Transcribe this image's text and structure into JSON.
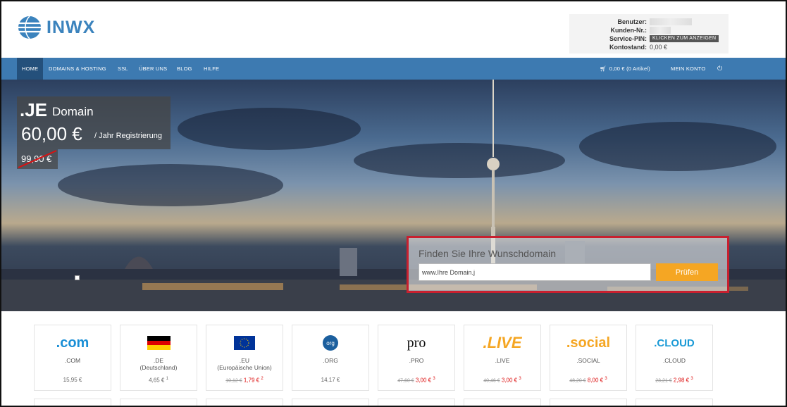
{
  "header": {
    "logo_text": "INWX",
    "account": {
      "user_label": "Benutzer:",
      "customer_label": "Kunden-Nr.:",
      "pin_label": "Service-PIN:",
      "pin_button": "KLICKEN ZUM ANZEIGEN",
      "balance_label": "Kontostand:",
      "balance_value": "0,00 €"
    }
  },
  "nav": {
    "items": [
      "HOME",
      "DOMAINS & HOSTING",
      "SSL",
      "ÜBER UNS",
      "BLOG",
      "HILFE"
    ],
    "cart": "0,00 € (0 Artikel)",
    "account": "MEIN KONTO"
  },
  "hero": {
    "promo_tld": ".JE",
    "promo_domain": "Domain",
    "promo_price": "60,00 €",
    "promo_per": "/ Jahr Registrierung",
    "promo_old_price": "99,90 €",
    "search_title": "Finden Sie Ihre Wunschdomain",
    "search_value": "www.Ihre Domain.j",
    "search_button": "Prüfen"
  },
  "tlds": [
    {
      "logo": ".com",
      "name": ".COM",
      "sub": "",
      "old": "",
      "price": "15,95 €",
      "sup": ""
    },
    {
      "logo": "flag-de",
      "name": ".DE",
      "sub": "(Deutschland)",
      "old": "",
      "price": "4,65 €",
      "sup": "1"
    },
    {
      "logo": "flag-eu",
      "name": ".EU",
      "sub": "(Europäische Union)",
      "old": "10,12 €",
      "price": "1,79 €",
      "sup": "2"
    },
    {
      "logo": "org",
      "name": ".ORG",
      "sub": "",
      "old": "",
      "price": "14,17 €",
      "sup": ""
    },
    {
      "logo": "pro",
      "name": ".PRO",
      "sub": "",
      "old": "47,60 €",
      "price": "3,00 €",
      "sup": "3"
    },
    {
      "logo": ".LIVE",
      "name": ".LIVE",
      "sub": "",
      "old": "40,46 €",
      "price": "3,00 €",
      "sup": "3"
    },
    {
      "logo": ".social",
      "name": ".SOCIAL",
      "sub": "",
      "old": "48,20 €",
      "price": "8,00 €",
      "sup": "3"
    },
    {
      "logo": ".CLOUD",
      "name": ".CLOUD",
      "sub": "",
      "old": "23,21 €",
      "price": "2,98 €",
      "sup": "3"
    }
  ],
  "colors": {
    "nav": "#3d7ab1",
    "nav_active": "#24507b",
    "search_border": "#c8202f",
    "button": "#f5a623",
    "sale": "#dd1111"
  }
}
